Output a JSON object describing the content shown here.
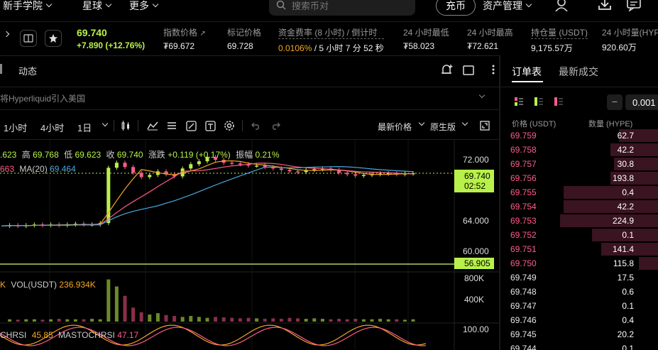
{
  "nav": {
    "items": [
      "新手学院",
      "星球",
      "更多"
    ],
    "search_placeholder": "搜索币对",
    "deposit": "充币",
    "assets": "资产管理"
  },
  "ticker": {
    "price": "69.740",
    "change": "+7.890 (+12.76%)",
    "fields": [
      {
        "label": "指数价格",
        "value": "₮69.672"
      },
      {
        "label": "标记价格",
        "value": "69.728"
      },
      {
        "label": "资金费率 (8 小时) / 倒计时",
        "rate": "0.0106%",
        "countdown": "/ 5 小时 7 分 52 秒"
      },
      {
        "label": "24 小时最低",
        "value": "₮58.023"
      },
      {
        "label": "24 小时最高",
        "value": "₮72.621"
      },
      {
        "label": "持仓量 (USDT)",
        "value": "9,175.57万"
      },
      {
        "label": "24 小时量(HYP",
        "value": "920.60万"
      }
    ]
  },
  "chart_toolbar": {
    "tab_dynamic": "动态",
    "news": "将Hyperliquid引入美国",
    "intervals": [
      "1小时",
      "4小时",
      "1日"
    ],
    "price_type": "最新价格",
    "version": "原生版"
  },
  "chart_info": {
    "ohlc_line": [
      {
        "k": "",
        "v": ".623"
      },
      {
        "k": "高",
        "v": "69.768"
      },
      {
        "k": "低",
        "v": "69.623"
      },
      {
        "k": "收",
        "v": "69.740"
      },
      {
        "k": "涨跌",
        "v": "+0.119 (+0.17%)"
      },
      {
        "k": "振幅",
        "v": "0.21%"
      }
    ],
    "ma_line": {
      "prefix": "663",
      "label": "MA(20)",
      "value": "69.464"
    },
    "vol_line": {
      "prefix": "K",
      "label": "VOL(USDT)",
      "value": "236.934K"
    },
    "stoch_line": {
      "prefix": "CHRSI",
      "v1": "45.85",
      "label": "MASTOCHRSI",
      "v2": "47.17"
    }
  },
  "chart_data": {
    "type": "line",
    "title": "",
    "y_ticks": [
      "72.000",
      "64.000",
      "60.000"
    ],
    "last_price": "69.740",
    "countdown": "02:52",
    "line_level": "56.905",
    "vol_ticks": [
      "800K",
      "400K"
    ],
    "stoch_tick": "100.00",
    "price_series": [
      62.4,
      62.5,
      62.4,
      62.5,
      62.6,
      62.5,
      62.6,
      62.5,
      62.6,
      62.7,
      62.6,
      62.6,
      62.8,
      70.5,
      71.2,
      70.6,
      69.8,
      69.2,
      69.5,
      70.0,
      69.6,
      69.3,
      70.4,
      71.0,
      71.4,
      72.0,
      71.6,
      71.2,
      71.1,
      71.0,
      70.8,
      70.8,
      70.6,
      70.4,
      70.2,
      70.0,
      69.9,
      70.2,
      70.3,
      70.4,
      70.2,
      69.8,
      69.6,
      69.4,
      69.5,
      69.6,
      69.7,
      69.7,
      69.6,
      69.7,
      69.74
    ],
    "volume_series": [
      0.05,
      0.04,
      0.05,
      0.05,
      0.04,
      0.05,
      0.06,
      0.05,
      0.05,
      0.05,
      0.06,
      0.05,
      0.9,
      0.75,
      0.55,
      0.3,
      0.2,
      0.15,
      0.18,
      0.14,
      0.12,
      0.1,
      0.12,
      0.1,
      0.08,
      0.1,
      0.09,
      0.08,
      0.07,
      0.08,
      0.07,
      0.06,
      0.07,
      0.06,
      0.08,
      0.07,
      0.06,
      0.07,
      0.06,
      0.05,
      0.06,
      0.05,
      0.06,
      0.05,
      0.05,
      0.06,
      0.05,
      0.05,
      0.04,
      0.05
    ]
  },
  "orderbook": {
    "tabs": [
      "订单表",
      "最新成交"
    ],
    "precision": "0.001",
    "col_price": "价格 (USDT)",
    "col_qty": "数量 (HYPE)",
    "asks": [
      {
        "price": "69.759",
        "qty": "62.7",
        "depth": 0.25
      },
      {
        "price": "69.758",
        "qty": "42.2",
        "depth": 0.3
      },
      {
        "price": "69.757",
        "qty": "30.8",
        "depth": 0.28
      },
      {
        "price": "69.756",
        "qty": "193.8",
        "depth": 0.3
      },
      {
        "price": "69.755",
        "qty": "0.4",
        "depth": 0.6
      },
      {
        "price": "69.754",
        "qty": "42.2",
        "depth": 0.6
      },
      {
        "price": "69.753",
        "qty": "224.9",
        "depth": 0.62
      },
      {
        "price": "69.752",
        "qty": "0.1",
        "depth": 0.42
      },
      {
        "price": "69.751",
        "qty": "141.4",
        "depth": 0.36
      },
      {
        "price": "69.750",
        "qty": "115.8",
        "depth": 0.12
      }
    ],
    "bids": [
      {
        "price": "69.749",
        "qty": "17.5"
      },
      {
        "price": "69.748",
        "qty": "0.6"
      },
      {
        "price": "69.747",
        "qty": "0.1"
      },
      {
        "price": "69.746",
        "qty": "0.4"
      },
      {
        "price": "69.745",
        "qty": "20.2"
      },
      {
        "price": "69.744",
        "qty": "0.1"
      }
    ]
  },
  "colors": {
    "up": "#b8f14a",
    "down": "#ff5c8a",
    "ma_blue": "#4aa8e0",
    "ask_bar": "#3a1420"
  }
}
